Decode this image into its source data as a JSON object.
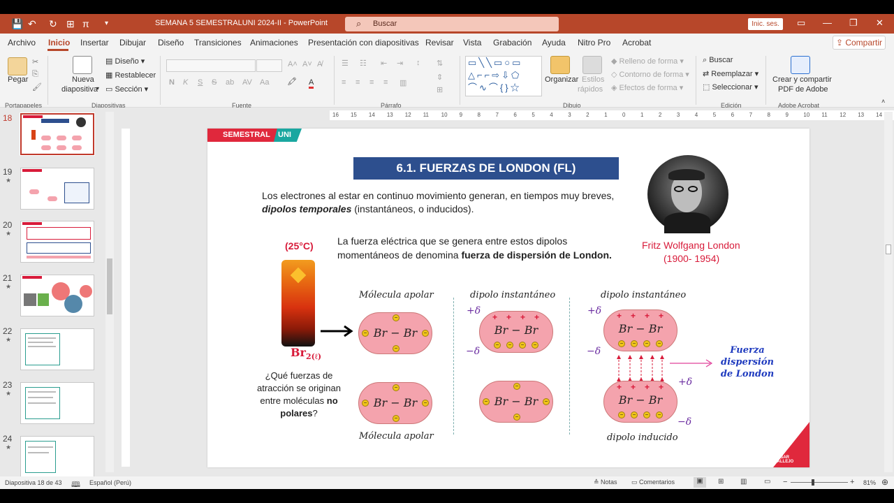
{
  "titlebar": {
    "doc_title": "SEMANA 5 SEMESTRALUNI 2024-II  -  PowerPoint",
    "search_placeholder": "Buscar",
    "signin": "Inic. ses."
  },
  "menu": {
    "tabs": [
      "Archivo",
      "Inicio",
      "Insertar",
      "Dibujar",
      "Diseño",
      "Transiciones",
      "Animaciones",
      "Presentación con diapositivas",
      "Revisar",
      "Vista",
      "Grabación",
      "Ayuda",
      "Nitro Pro",
      "Acrobat"
    ],
    "share": "Compartir"
  },
  "ribbon": {
    "paste": "Pegar",
    "new_slide": "Nueva",
    "new_slide2": "diapositiva",
    "layout": "Diseño",
    "reset": "Restablecer",
    "section": "Sección",
    "arrange": "Organizar",
    "styles": "Estilos",
    "styles2": "rápidos",
    "shape_fill": "Relleno de forma",
    "shape_outline": "Contorno de forma",
    "shape_effects": "Efectos de forma",
    "find": "Buscar",
    "replace": "Reemplazar",
    "select": "Seleccionar",
    "adobe1": "Crear y compartir",
    "adobe2": "PDF de Adobe",
    "groups": {
      "clipboard": "Portapapeles",
      "slides": "Diapositivas",
      "font": "Fuente",
      "paragraph": "Párrafo",
      "drawing": "Dibujo",
      "editing": "Edición",
      "acrobat": "Adobe Acrobat"
    }
  },
  "thumbnails": [
    {
      "num": "18"
    },
    {
      "num": "19",
      "star": "★"
    },
    {
      "num": "20",
      "star": "★"
    },
    {
      "num": "21",
      "star": "★"
    },
    {
      "num": "22",
      "star": "★"
    },
    {
      "num": "23",
      "star": "★"
    },
    {
      "num": "24",
      "star": "★"
    }
  ],
  "ruler_ticks": [
    "16",
    "15",
    "14",
    "13",
    "12",
    "11",
    "10",
    "9",
    "8",
    "7",
    "6",
    "5",
    "4",
    "3",
    "2",
    "1",
    "0",
    "1",
    "2",
    "3",
    "4",
    "5",
    "6",
    "7",
    "8",
    "9",
    "10",
    "11",
    "12",
    "13",
    "14",
    "15",
    "16"
  ],
  "slide": {
    "header_a": "SEMESTRAL",
    "header_b": "UNI",
    "title": "6.1.  FUERZAS DE LONDON (FL)",
    "intro_1": "Los electrones al estar en continuo movimiento generan, en tiempos muy breves,",
    "intro_2_bold": "dipolos temporales",
    "intro_2_rest": " (instantáneos, o inducidos).",
    "temp": "(25°C)",
    "force_1": "La fuerza eléctrica que se genera entre estos dipolos",
    "force_2a": "momentáneos de denomina ",
    "force_2b": "fuerza de dispersión de London.",
    "scientist_name": "Fritz Wolfgang London",
    "scientist_years": "(1900- 1954)",
    "br2": "Br",
    "br2_sub": "2(ℓ)",
    "question_1": "¿Qué fuerzas de",
    "question_2": "atracción se originan",
    "question_3a": "entre moléculas ",
    "question_3b": "no",
    "question_4a": "polares",
    "question_4b": "?",
    "lbl_apolar_top": "Mólecula apolar",
    "lbl_apolar_bottom": "Mólecula apolar",
    "lbl_dip1": "dipolo instantáneo",
    "lbl_dip2": "dipolo instantáneo",
    "lbl_induced": "dipolo inducido",
    "formula": "Br  − Br",
    "plus_delta": "+δ",
    "minus_delta": "−δ",
    "plus": "+",
    "minus": "−",
    "london_1": "Fuerza",
    "london_2": "dispersión",
    "london_3": "de London",
    "logo": "CESAR VALLEJO"
  },
  "status": {
    "slide_of": "Diapositiva 18 de 43",
    "language": "Español (Perú)",
    "notes": "Notas",
    "comments": "Comentarios",
    "zoom": "81%"
  },
  "colors": {
    "accent": "#b7472a",
    "title_blue": "#2d4f8e",
    "red": "#d81b3a",
    "pill": "#f4a3ad",
    "purple": "#6a2ca0"
  }
}
